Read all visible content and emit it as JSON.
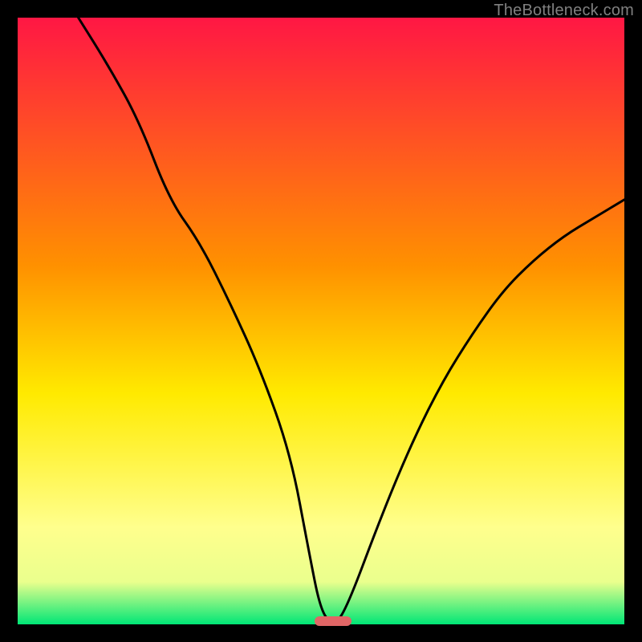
{
  "attribution": "TheBottleneck.com",
  "colors": {
    "grad_top": "#ff1744",
    "grad_mid1": "#ff9100",
    "grad_mid2": "#ffea00",
    "grad_mid3": "#ffff8d",
    "grad_bottom": "#00e676",
    "curve": "#000000",
    "marker": "#e06666",
    "frame": "#000000"
  },
  "chart_data": {
    "type": "line",
    "title": "",
    "xlabel": "",
    "ylabel": "",
    "xlim": [
      0,
      100
    ],
    "ylim": [
      0,
      100
    ],
    "grid": false,
    "legend": "none",
    "x": [
      10,
      15,
      20,
      25,
      30,
      35,
      40,
      45,
      48,
      50,
      52,
      54,
      60,
      65,
      70,
      75,
      80,
      85,
      90,
      95,
      100
    ],
    "values": [
      100,
      92,
      83,
      70,
      63,
      53,
      42,
      28,
      12,
      2,
      0,
      2,
      18,
      30,
      40,
      48,
      55,
      60,
      64,
      67,
      70
    ],
    "notch_x": 52,
    "marker": {
      "x_start": 49,
      "x_end": 55,
      "y": 0
    }
  }
}
